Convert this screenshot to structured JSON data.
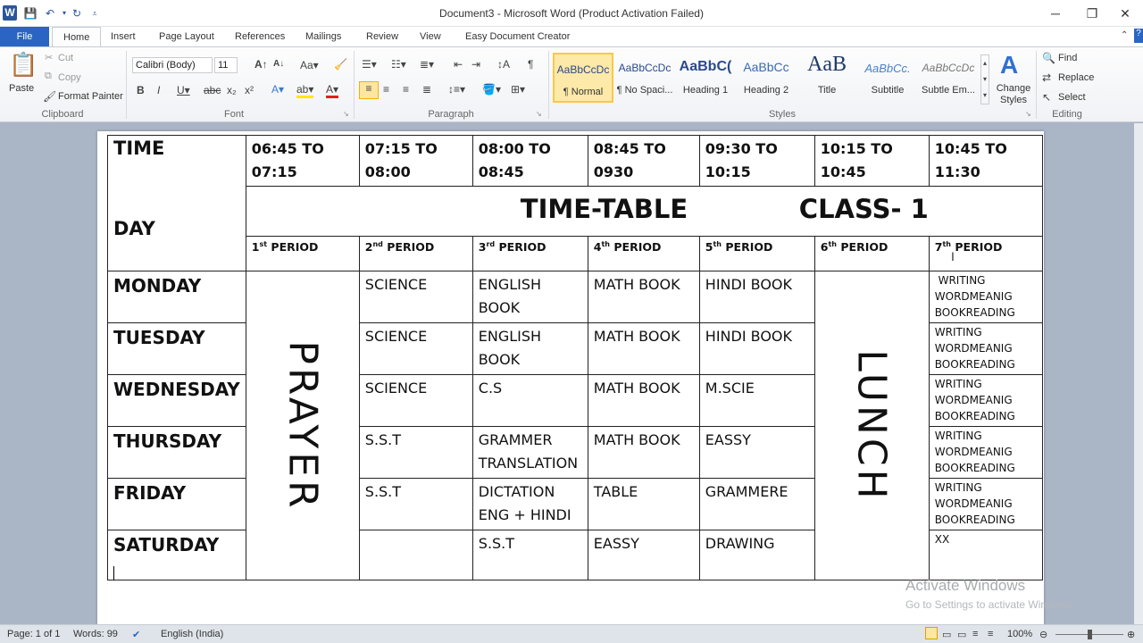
{
  "window": {
    "title": "Document3 - Microsoft Word (Product Activation Failed)",
    "app_logo": "W",
    "buttons": {
      "minimize": "─",
      "restore": "❐",
      "close": "✕"
    }
  },
  "tabs": {
    "file": "File",
    "items": [
      "Home",
      "Insert",
      "Page Layout",
      "References",
      "Mailings",
      "Review",
      "View",
      "Easy Document Creator"
    ]
  },
  "ribbon": {
    "clipboard": {
      "paste": "Paste",
      "cut": "Cut",
      "copy": "Copy",
      "format_painter": "Format Painter",
      "label": "Clipboard"
    },
    "font": {
      "name": "Calibri (Body)",
      "size": "11",
      "label": "Font"
    },
    "paragraph": {
      "label": "Paragraph"
    },
    "styles": {
      "label": "Styles",
      "items": [
        {
          "sample": "AaBbCcDc",
          "name": "¶ Normal"
        },
        {
          "sample": "AaBbCcDc",
          "name": "¶ No Spaci..."
        },
        {
          "sample": "AaBbC(",
          "name": "Heading 1"
        },
        {
          "sample": "AaBbCc",
          "name": "Heading 2"
        },
        {
          "sample": "AaB",
          "name": "Title"
        },
        {
          "sample": "AaBbCc.",
          "name": "Subtitle"
        },
        {
          "sample": "AaBbCcDc",
          "name": "Subtle Em..."
        }
      ],
      "change_styles": "Change Styles"
    },
    "editing": {
      "find": "Find",
      "replace": "Replace",
      "select": "Select",
      "label": "Editing"
    }
  },
  "table": {
    "time_label": "TIME",
    "day_label": "DAY",
    "slots": [
      [
        "06:45 TO",
        "07:15"
      ],
      [
        "07:15 TO",
        "08:00"
      ],
      [
        "08:00 TO",
        "08:45"
      ],
      [
        "08:45 TO",
        "0930"
      ],
      [
        "09:30 TO",
        "10:15"
      ],
      [
        "10:15 TO",
        "10:45"
      ],
      [
        "10:45 TO",
        "11:30"
      ]
    ],
    "banner_title": "TIME-TABLE",
    "banner_class": "CLASS- 1",
    "periods": [
      {
        "num": "1",
        "sup": "st",
        "label": " PERIOD"
      },
      {
        "num": "2",
        "sup": "nd",
        "label": " PERIOD"
      },
      {
        "num": "3",
        "sup": "rd",
        "label": " PERIOD"
      },
      {
        "num": "4",
        "sup": "th",
        "label": " PERIOD"
      },
      {
        "num": "5",
        "sup": "th",
        "label": " PERIOD"
      },
      {
        "num": "6",
        "sup": "th",
        "label": " PERIOD"
      },
      {
        "num": "7",
        "sup": "th",
        "label": " PERIOD"
      }
    ],
    "prayer": "PRAYER",
    "lunch": "LUNCH",
    "days": [
      {
        "day": "MONDAY",
        "p2": "SCIENCE",
        "p3": [
          "ENGLISH",
          "BOOK"
        ],
        "p4": "MATH BOOK",
        "p5": "HINDI  BOOK",
        "p7": [
          " WRITING",
          "WORDMEANIG",
          "BOOKREADING"
        ]
      },
      {
        "day": "TUESDAY",
        "p2": "SCIENCE",
        "p3": [
          "ENGLISH",
          "BOOK"
        ],
        "p4": "MATH BOOK",
        "p5": "HINDI  BOOK",
        "p7": [
          "WRITING",
          "WORDMEANIG",
          "BOOKREADING"
        ]
      },
      {
        "day": "WEDNESDAY",
        "p2": "SCIENCE",
        "p3": [
          "C.S",
          ""
        ],
        "p4": "MATH BOOK",
        "p5": "M.SCIE",
        "p7": [
          "WRITING",
          "WORDMEANIG",
          "BOOKREADING"
        ]
      },
      {
        "day": "THURSDAY",
        "p2": "S.S.T",
        "p3": [
          "GRAMMER",
          "TRANSLATION"
        ],
        "p4": "MATH BOOK",
        "p5": "EASSY",
        "p7": [
          "WRITING",
          "WORDMEANIG",
          "BOOKREADING"
        ]
      },
      {
        "day": "FRIDAY",
        "p2": "S.S.T",
        "p3": [
          "DICTATION",
          "ENG + HINDI"
        ],
        "p4": "TABLE",
        "p5": "GRAMMERE",
        "p7": [
          "WRITING",
          "WORDMEANIG",
          "BOOKREADING"
        ]
      },
      {
        "day": "SATURDAY",
        "p2": "",
        "p3": [
          "S.S.T",
          ""
        ],
        "p4": "EASSY",
        "p5": "DRAWING",
        "p7": [
          "XX",
          "",
          ""
        ]
      }
    ]
  },
  "watermark": {
    "line1": "Activate Windows",
    "line2": "Go to Settings to activate Windows."
  },
  "status": {
    "page": "Page: 1 of 1",
    "words": "Words: 99",
    "language": "English (India)",
    "zoom": "100%"
  }
}
